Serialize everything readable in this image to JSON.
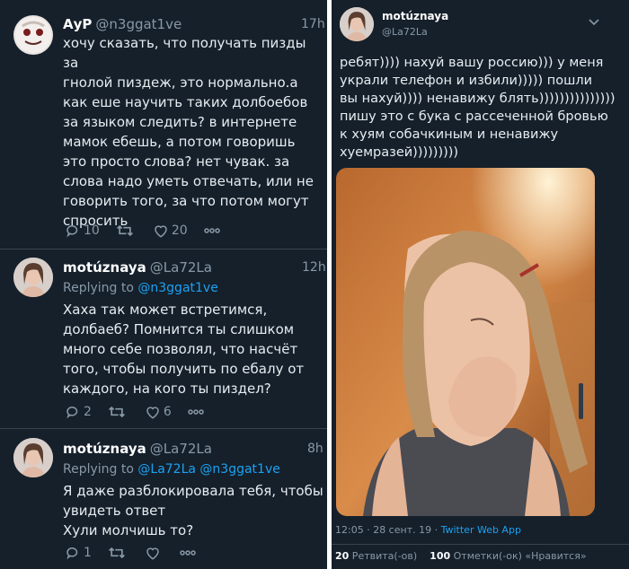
{
  "left": {
    "tweets": [
      {
        "name": "АуР",
        "handle": "@n3ggat1ve",
        "time": "17h",
        "text": "хочу сказать, что получать пизды за\nгнолой пиздеж,  это нормально.а\nкак  еше научить таких долбоебов\nза языком следить? в  интернете\nмамок ебешь, а потом говоришь\nэто просто  слова? нет чувак. за\nслова надо уметь отвечать, или не\nговорить того, за  что потом могут\nспросить",
        "replies": "10",
        "retweets": "",
        "likes": "20"
      },
      {
        "name": "motúznaya",
        "handle": "@La72La",
        "time": "12h",
        "replying_prefix": "Replying to",
        "replying_to": "@n3ggat1ve",
        "text": "Хаха так может встретимся,\nдолбаеб? Помнится ты слишком\nмного себе позволял, что насчёт\nтого, чтобы получить по ебалу от\nкаждого, на кого ты пиздел?",
        "replies": "2",
        "retweets": "",
        "likes": "6"
      },
      {
        "name": "motúznaya",
        "handle": "@La72La",
        "time": "8h",
        "replying_prefix": "Replying to",
        "replying_to": "@La72La @n3ggat1ve",
        "text": "Я даже разблокировала тебя, чтобы\nувидеть ответ\nХули молчишь то?",
        "replies": "1",
        "retweets": "",
        "likes": ""
      }
    ]
  },
  "right": {
    "name": "motúznaya",
    "handle": "@La72La",
    "text": "ребят)))) нахуй вашу россию))) у меня\nукрали телефон и избили))))) пошли\nвы нахуй)))) ненавижу блять)))))))))))))))\nпишу это с бука с рассеченной бровью\nк хуям собачкиным и ненавижу\nхуемразей)))))))))",
    "meta_time": "12:05 · 28 сент. 19 · ",
    "meta_app": "Twitter Web App",
    "retweets_count": "20",
    "retweets_label": " Ретвита(-ов)",
    "likes_count": "100",
    "likes_label": " Отметки(-ок) «Нравится»"
  },
  "colors": {
    "background": "#15202b",
    "text": "#e6ecf0",
    "muted": "#8899a6",
    "accent": "#1da1f2",
    "divider": "#38444d"
  },
  "icons": [
    "reply-icon",
    "retweet-icon",
    "like-icon",
    "more-icon",
    "chevron-down-icon"
  ]
}
